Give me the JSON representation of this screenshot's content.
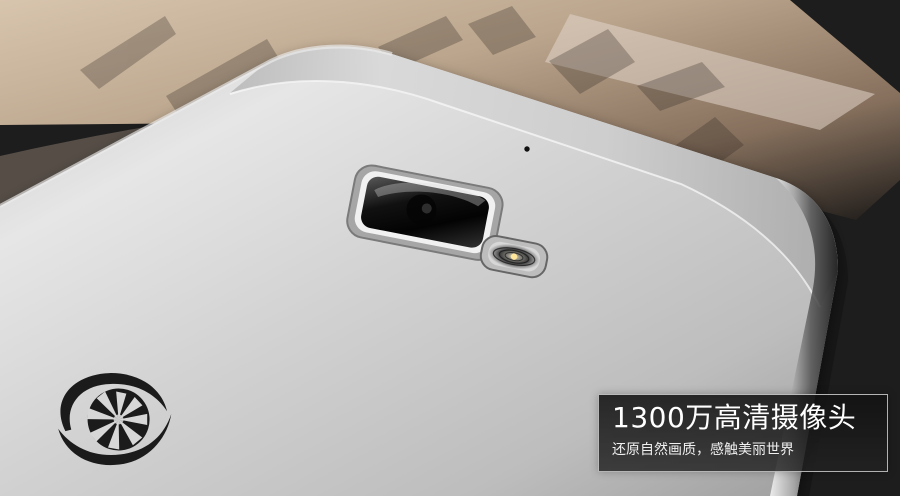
{
  "caption": {
    "title": "1300万高清摄像头",
    "subtitle": "还原自然画质，感触美丽世界"
  },
  "icons": {
    "logo": "citrus-slice-logo-icon",
    "camera": "rear-camera-lens-icon",
    "flash": "led-flash-icon",
    "microphone": "microphone-hole-icon"
  },
  "colors": {
    "phone_silver": "#d8d8d8",
    "background_paper": "#c8b39d",
    "caption_background": "#1d1d1d",
    "caption_border": "#e6e6e6"
  }
}
